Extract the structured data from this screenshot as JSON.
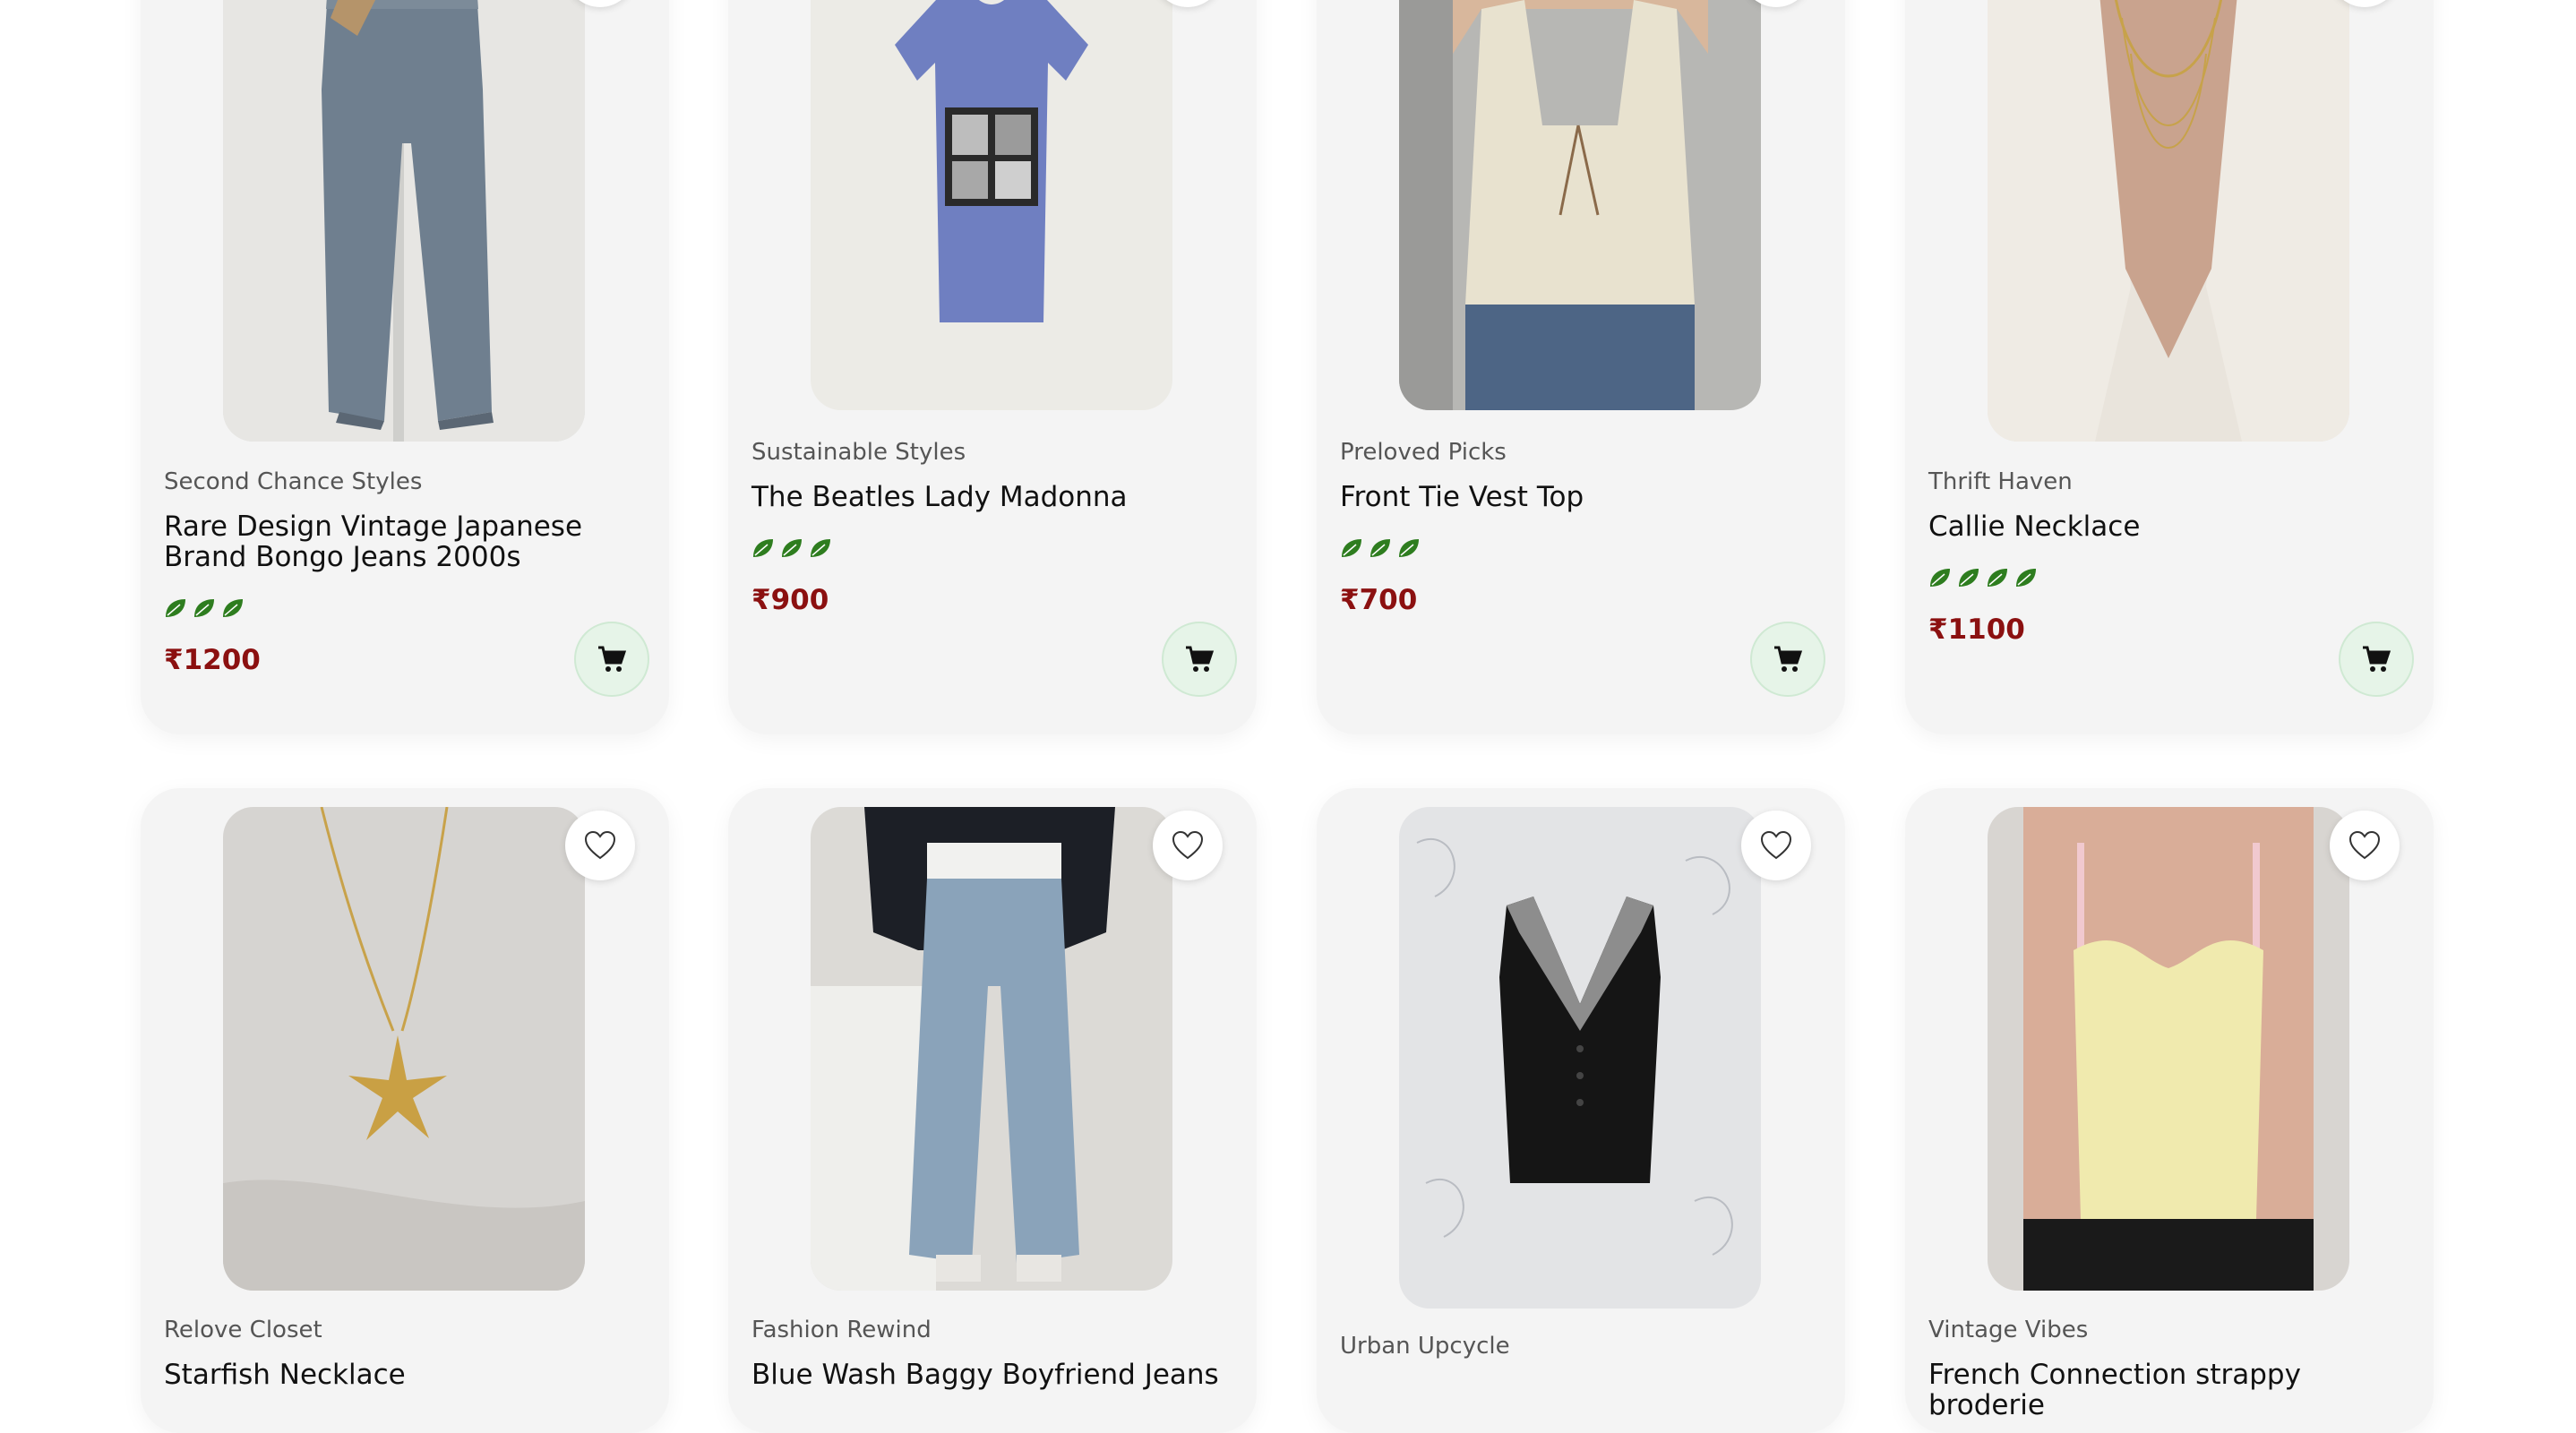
{
  "colors": {
    "card_bg": "#f4f4f4",
    "price": "#8b1010",
    "leaf": "#2e7d1f",
    "cart_bg": "#e6f4e8"
  },
  "icons": {
    "favorite": "heart-outline-icon",
    "cart": "shopping-cart-icon",
    "eco_rating": "leaf-icon"
  },
  "products": [
    {
      "seller": "Second Chance Styles",
      "title": "Rare Design Vintage Japanese Brand Bongo Jeans 2000s",
      "price": "₹1200",
      "eco_leaves": 3
    },
    {
      "seller": "Sustainable Styles",
      "title": "The Beatles Lady Madonna",
      "price": "₹900",
      "eco_leaves": 3
    },
    {
      "seller": "Preloved Picks",
      "title": "Front Tie Vest Top",
      "price": "₹700",
      "eco_leaves": 3
    },
    {
      "seller": "Thrift Haven",
      "title": "Callie Necklace",
      "price": "₹1100",
      "eco_leaves": 4
    },
    {
      "seller": "Relove Closet",
      "title": "Starfish Necklace"
    },
    {
      "seller": "Fashion Rewind",
      "title": "Blue Wash Baggy Boyfriend Jeans"
    },
    {
      "seller": "Urban Upcycle",
      "title": ""
    },
    {
      "seller": "Vintage Vibes",
      "title": "French Connection strappy broderie"
    }
  ]
}
